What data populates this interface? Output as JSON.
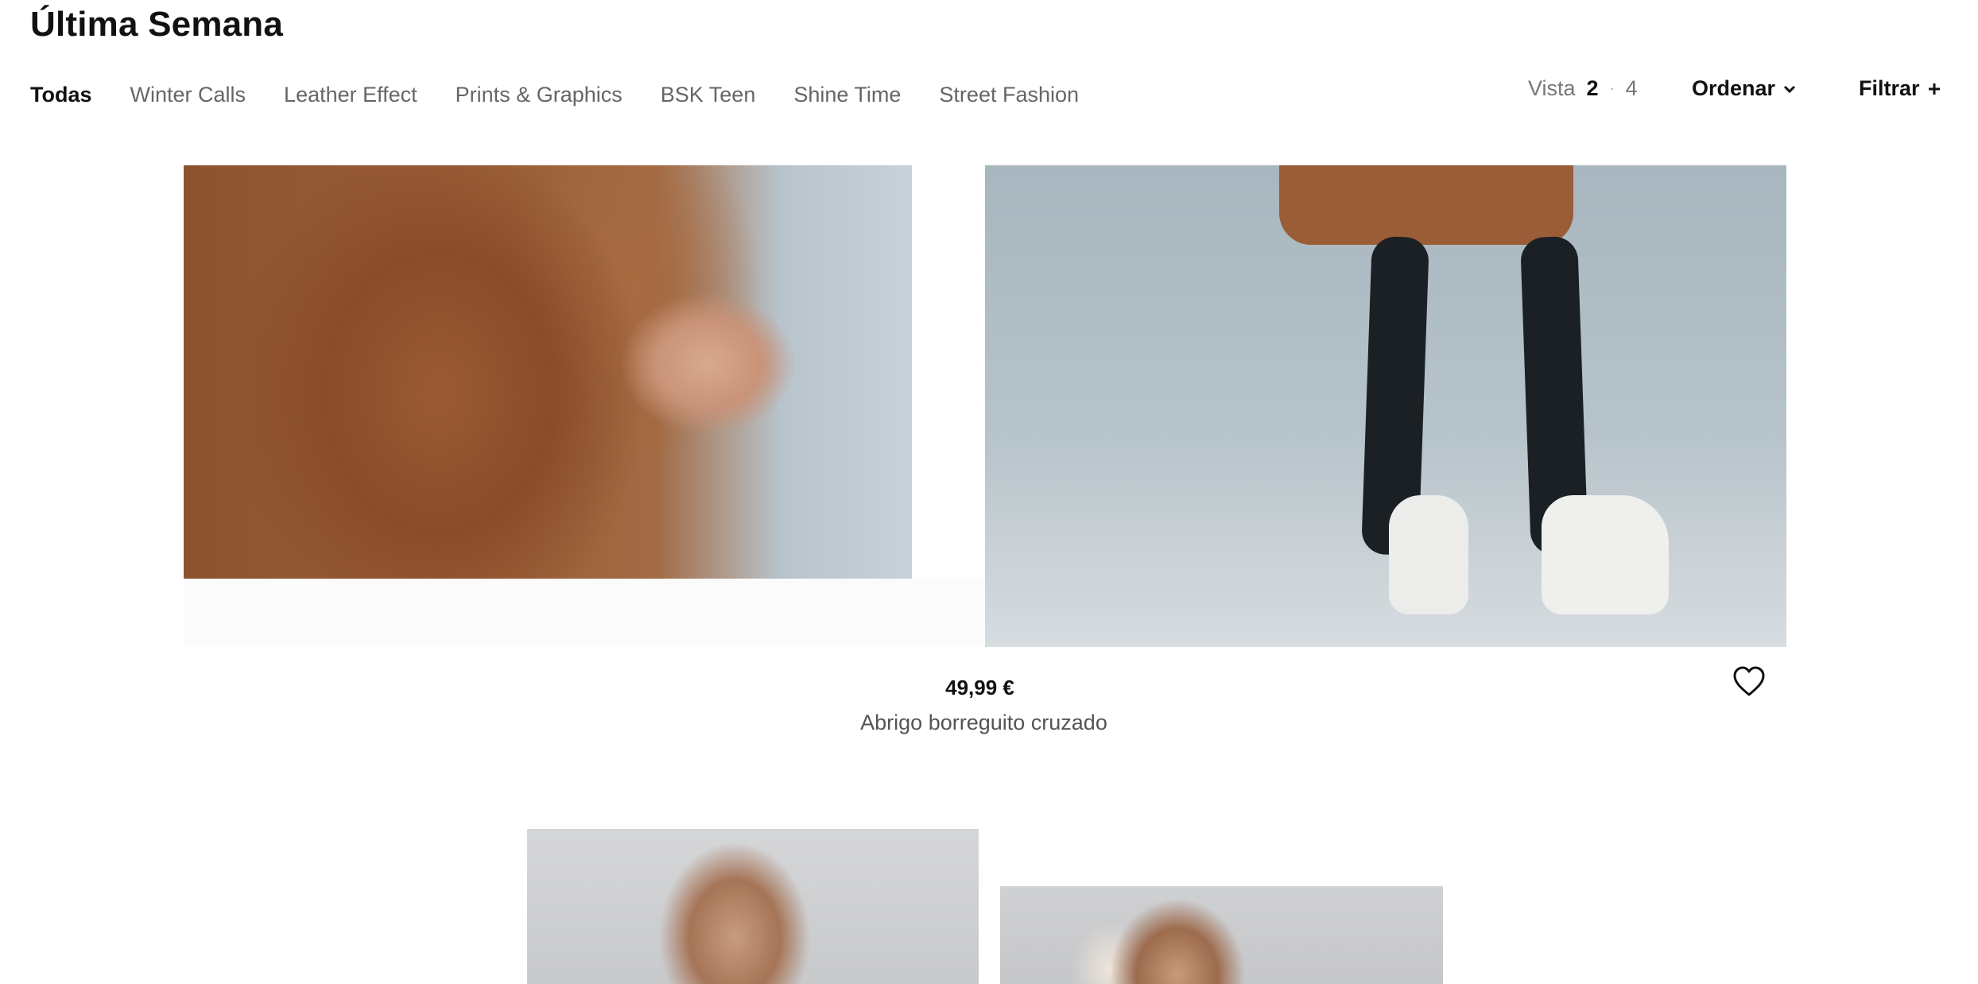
{
  "page": {
    "title": "Última Semana"
  },
  "categories": [
    {
      "label": "Todas",
      "active": true
    },
    {
      "label": "Winter Calls",
      "active": false
    },
    {
      "label": "Leather Effect",
      "active": false
    },
    {
      "label": "Prints & Graphics",
      "active": false
    },
    {
      "label": "BSK Teen",
      "active": false
    },
    {
      "label": "Shine Time",
      "active": false
    },
    {
      "label": "Street Fashion",
      "active": false
    }
  ],
  "toolbar": {
    "view_label": "Vista",
    "view_options": [
      "2",
      "4"
    ],
    "view_separator": "·",
    "sort_label": "Ordenar",
    "filter_label": "Filtrar"
  },
  "product": {
    "price": "49,99 €",
    "name": "Abrigo borreguito cruzado"
  },
  "icons": {
    "sort": "chevron-down-icon",
    "filter": "plus-icon",
    "wishlist": "heart-icon"
  }
}
